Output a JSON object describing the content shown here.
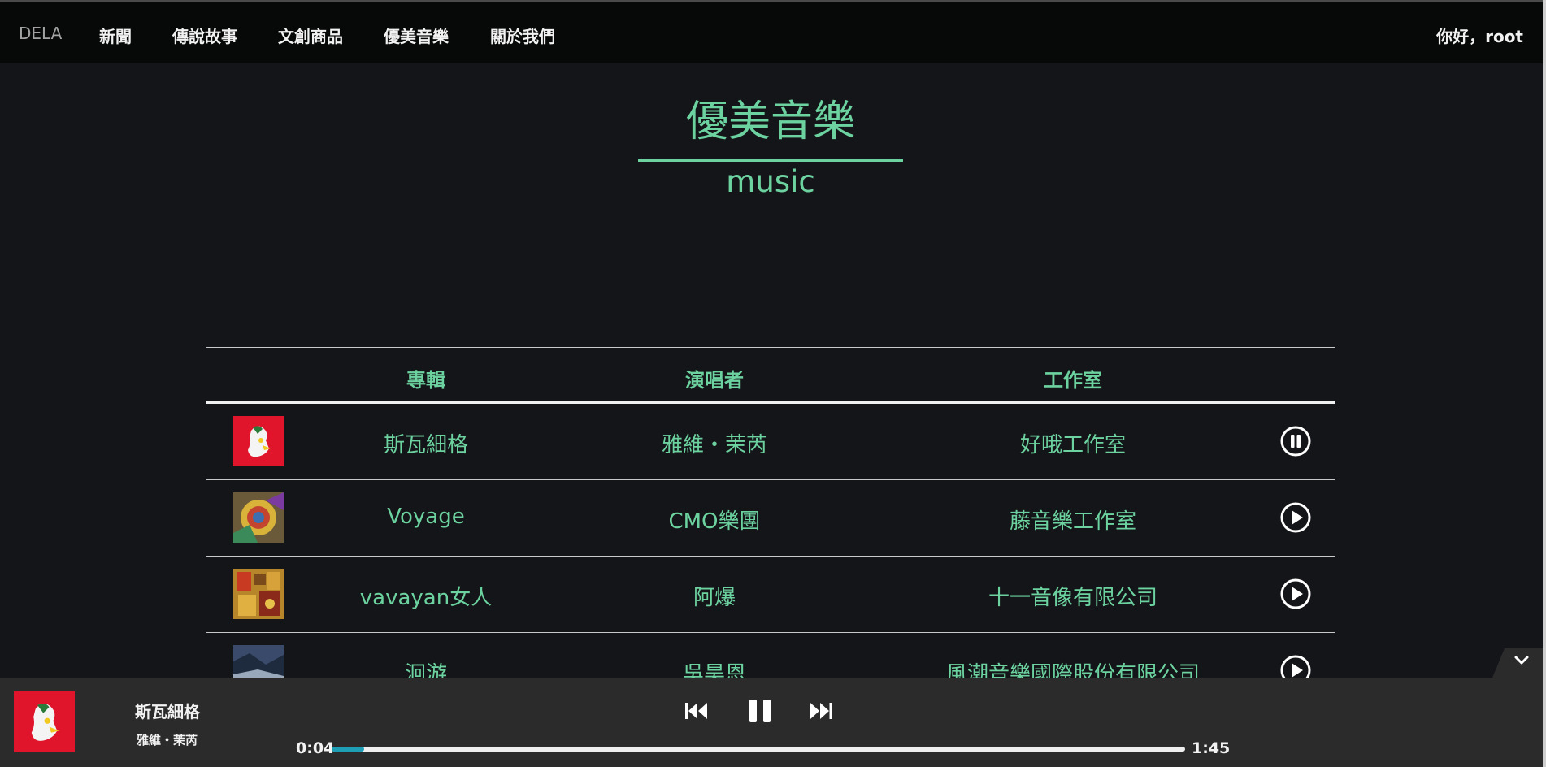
{
  "nav": {
    "brand": "DELA",
    "items": [
      "新聞",
      "傳說故事",
      "文創商品",
      "優美音樂",
      "關於我們"
    ],
    "greeting": "你好，root"
  },
  "heading": {
    "title": "優美音樂",
    "subtitle": "music"
  },
  "table": {
    "headers": [
      "專輯",
      "演唱者",
      "工作室"
    ],
    "rows": [
      {
        "album": "斯瓦細格",
        "artist": "雅維・茉芮",
        "studio": "好哦工作室",
        "state": "pause"
      },
      {
        "album": "Voyage",
        "artist": "CMO樂團",
        "studio": "藤音樂工作室",
        "state": "play"
      },
      {
        "album": "vavayan女人",
        "artist": "阿爆",
        "studio": "十一音像有限公司",
        "state": "play"
      },
      {
        "album": "洄游",
        "artist": "吳昊恩",
        "studio": "風潮音樂國際股份有限公司",
        "state": "play"
      }
    ]
  },
  "player": {
    "title": "斯瓦細格",
    "artist": "雅維・茉芮",
    "current_time": "0:04",
    "duration": "1:45",
    "progress_fraction": 0.038
  },
  "colors": {
    "accent": "#6cd3a0",
    "background": "#141518",
    "navbar": "#070808",
    "player": "#2b2b2c",
    "progress_fill": "#1f9fb5"
  },
  "icons": {
    "row_pause": "pause-circle-icon",
    "row_play": "play-circle-icon",
    "prev": "skip-previous-icon",
    "pause": "pause-icon",
    "next": "skip-next-icon",
    "collapse": "chevron-down-icon"
  }
}
